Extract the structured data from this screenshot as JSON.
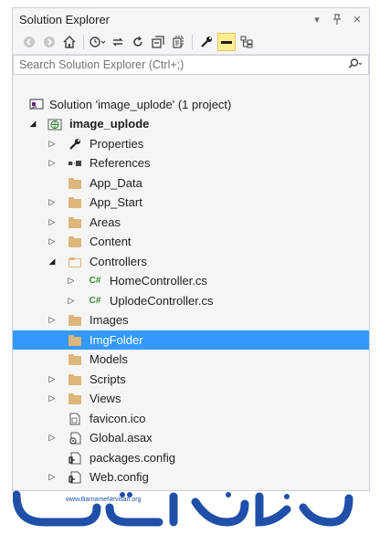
{
  "window": {
    "title": "Solution Explorer",
    "controls": [
      "dropdown-icon",
      "pin-icon",
      "close-icon"
    ]
  },
  "toolbar": {
    "buttons": [
      "back-icon",
      "forward-icon",
      "home-icon",
      "history-icon",
      "sync-icon",
      "refresh-icon",
      "collapse-all-icon",
      "show-all-files-icon",
      "properties-icon",
      "preview-icon",
      "class-view-icon"
    ]
  },
  "search": {
    "placeholder": "Search Solution Explorer (Ctrl+;)"
  },
  "tree": {
    "solution": "Solution 'image_uplode' (1 project)",
    "project": "image_uplode",
    "items": [
      {
        "label": "Properties",
        "icon": "wrench-icon"
      },
      {
        "label": "References",
        "icon": "references-icon"
      },
      {
        "label": "App_Data",
        "icon": "folder-icon"
      },
      {
        "label": "App_Start",
        "icon": "folder-icon"
      },
      {
        "label": "Areas",
        "icon": "folder-icon"
      },
      {
        "label": "Content",
        "icon": "folder-icon"
      },
      {
        "label": "Controllers",
        "icon": "folder-open-icon"
      },
      {
        "label": "HomeController.cs",
        "icon": "csharp-file-icon"
      },
      {
        "label": "UplodeController.cs",
        "icon": "csharp-file-icon"
      },
      {
        "label": "Images",
        "icon": "folder-icon"
      },
      {
        "label": "ImgFolder",
        "icon": "folder-icon"
      },
      {
        "label": "Models",
        "icon": "folder-icon"
      },
      {
        "label": "Scripts",
        "icon": "folder-icon"
      },
      {
        "label": "Views",
        "icon": "folder-icon"
      },
      {
        "label": "favicon.ico",
        "icon": "ico-file-icon"
      },
      {
        "label": "Global.asax",
        "icon": "asax-file-icon"
      },
      {
        "label": "packages.config",
        "icon": "config-file-icon"
      },
      {
        "label": "Web.config",
        "icon": "config-file-icon"
      }
    ],
    "selected": "ImgFolder"
  },
  "colors": {
    "selection": "#3399ff",
    "folder": "#dcb67a",
    "csharp": "#388a34",
    "logo": "#1f4fa8"
  },
  "watermark": {
    "site": "www.BarnameNevisan.org",
    "brand": "برنامه نویسان"
  }
}
